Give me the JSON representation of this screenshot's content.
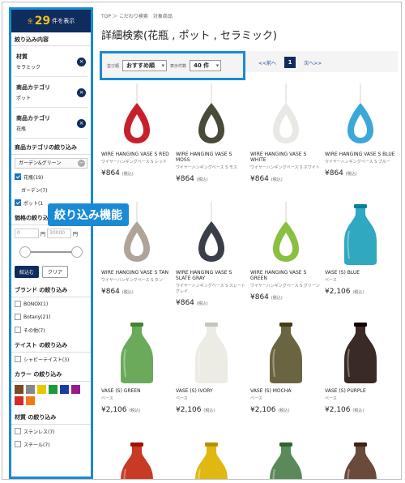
{
  "sidebar": {
    "count_prefix": "全",
    "count": "29",
    "count_suffix": "件を表示",
    "active_heading": "絞り込み内容",
    "active_filters": [
      {
        "title": "材質",
        "value": "セラミック"
      },
      {
        "title": "商品カテゴリ",
        "value": "ポット"
      },
      {
        "title": "商品カテゴリ",
        "value": "花瓶"
      }
    ],
    "category_title": "商品カテゴリの絞り込み",
    "category_select": "ガーデン&グリーン",
    "categories": [
      {
        "label": "花瓶(19)",
        "checked": true,
        "indent": false
      },
      {
        "label": "ガーデン(7)",
        "checked": false,
        "indent": true
      },
      {
        "label": "ポット(1",
        "checked": true,
        "indent": false
      }
    ],
    "price_title": "価格の絞り込",
    "price_min": "0",
    "price_max": "30000",
    "price_unit": "円",
    "apply_label": "絞込む",
    "clear_label": "クリア",
    "brand_title": "ブランド の絞り込み",
    "brands": [
      "BONOX(1)",
      "Botany(21)",
      "その他(7)"
    ],
    "taste_title": "テイスト の絞り込み",
    "tastes": [
      "シャビーテイスト(3)"
    ],
    "color_title": "カラー の絞り込み",
    "colors": [
      "#7a4a24",
      "#888888",
      "#e8c800",
      "#1a9a3a",
      "#1a3aa8",
      "#9a1a8a",
      "#d42a2a",
      "#f07a1a"
    ],
    "material_title": "材質 の絞り込み",
    "materials": [
      "ステンレス(7)",
      "スチール(7)"
    ]
  },
  "breadcrumb": "TOP ＞ こだわり検索　対象商品",
  "page_title": "詳細検索(花瓶 , ポット , セラミック)",
  "toolbar": {
    "sort_label": "並び順",
    "sort_value": "おすすめ順",
    "per_page_label": "表示件数",
    "per_page_value": "40 件",
    "prev_label": "<<前へ",
    "current_page": "1",
    "next_label": "次へ>>"
  },
  "badge_label": "絞り込み機能",
  "products": [
    {
      "name": "WIRE HANGING VASE S RED",
      "sub": "ワイヤーハンギングベース S レッド",
      "price": "¥864",
      "tax": "(税込)",
      "kind": "teardrop",
      "color": "#c8202a"
    },
    {
      "name": "WIRE HANGING VASE S MOSS",
      "sub": "ワイヤーハンギングベース S モス",
      "price": "¥864",
      "tax": "(税込)",
      "kind": "teardrop",
      "color": "#4a4a38"
    },
    {
      "name": "WIRE HANGING VASE S WHITE",
      "sub": "ワイヤーハンギングベース S ホワイト",
      "price": "¥864",
      "tax": "(税込)",
      "kind": "teardrop",
      "color": "#e8e8e4"
    },
    {
      "name": "WIRE HANGING VASE S BLUE",
      "sub": "ワイヤーハンギングベース S ブルー",
      "price": "¥864",
      "tax": "(税込)",
      "kind": "teardrop",
      "color": "#3aa8d8"
    },
    {
      "name": "WIRE HANGING VASE S TAN",
      "sub": "ワイヤーハンギングベース S タン",
      "price": "¥864",
      "tax": "(税込)",
      "kind": "teardrop",
      "color": "#b0a498"
    },
    {
      "name": "WIRE HANGING VASE S SLATE GRAY",
      "sub": "ワイヤーハンギングベース S スレートグレイ",
      "price": "¥864",
      "tax": "(税込)",
      "kind": "teardrop",
      "color": "#3a3e48"
    },
    {
      "name": "WIRE HANGING VASE S GREEN",
      "sub": "ワイヤーハンギングベース S グリーン",
      "price": "¥864",
      "tax": "(税込)",
      "kind": "teardrop",
      "color": "#8ac040"
    },
    {
      "name": "VASE (S) BLUE",
      "sub": "ベース",
      "price": "¥2,106",
      "tax": "(税込)",
      "kind": "bottle",
      "color": "#30a8c0"
    },
    {
      "name": "VASE (S) GREEN",
      "sub": "ベース",
      "price": "¥2,106",
      "tax": "(税込)",
      "kind": "bottle",
      "color": "#6aaa5a"
    },
    {
      "name": "VASE (S) IVORY",
      "sub": "ベース",
      "price": "¥2,106",
      "tax": "(税込)",
      "kind": "bottle",
      "color": "#ecebe4"
    },
    {
      "name": "VASE (S) MOCHA",
      "sub": "ベース",
      "price": "¥2,106",
      "tax": "(税込)",
      "kind": "bottle",
      "color": "#6a6440"
    },
    {
      "name": "VASE (S) PURPLE",
      "sub": "ベース",
      "price": "¥2,106",
      "tax": "(税込)",
      "kind": "bottle",
      "color": "#3a2a26"
    },
    {
      "name": "",
      "sub": "",
      "price": "",
      "tax": "",
      "kind": "bottle",
      "color": "#c83a24"
    },
    {
      "name": "",
      "sub": "",
      "price": "",
      "tax": "",
      "kind": "bottle",
      "color": "#e0b810"
    },
    {
      "name": "",
      "sub": "",
      "price": "",
      "tax": "",
      "kind": "bottle",
      "color": "#5a8a5a"
    },
    {
      "name": "",
      "sub": "",
      "price": "",
      "tax": "",
      "kind": "bottle",
      "color": "#6a4a3a"
    }
  ]
}
